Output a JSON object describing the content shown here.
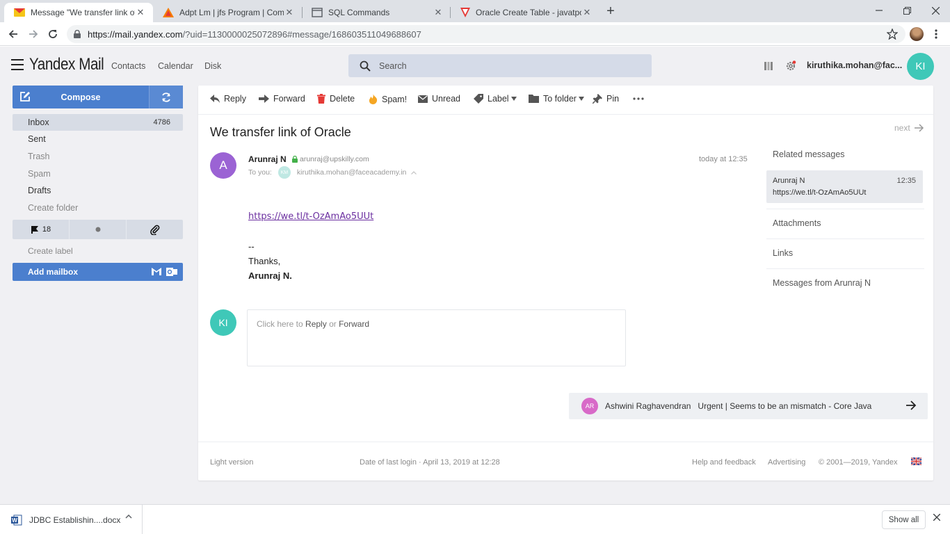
{
  "browser": {
    "tabs": [
      {
        "title": "Message \"We transfer link of Ora",
        "icon": "yandex-mail-icon"
      },
      {
        "title": "Adpt Lm | jfs Program | Comodo",
        "icon": "triangle-logo-icon"
      },
      {
        "title": "SQL Commands",
        "icon": "page-icon"
      },
      {
        "title": "Oracle Create Table - javatpoint",
        "icon": "javatpoint-icon"
      }
    ],
    "url_host": "https://mail.yandex.com",
    "url_path": "/?uid=1130000025072896#message/168603511049688607"
  },
  "header": {
    "logo": "Yandex Mail",
    "nav": [
      "Contacts",
      "Calendar",
      "Disk"
    ],
    "search_placeholder": "Search",
    "user_email": "kiruthika.mohan@fac...",
    "user_initials": "KI"
  },
  "sidebar": {
    "compose_label": "Compose",
    "folders": [
      {
        "label": "Inbox",
        "count": "4786"
      },
      {
        "label": "Sent",
        "count": ""
      },
      {
        "label": "Trash",
        "count": ""
      },
      {
        "label": "Spam",
        "count": ""
      },
      {
        "label": "Drafts",
        "count": ""
      },
      {
        "label": "Create folder",
        "count": ""
      }
    ],
    "flag_count": "18",
    "create_label": "Create label",
    "add_mailbox": "Add mailbox"
  },
  "toolbar": {
    "reply": "Reply",
    "forward": "Forward",
    "delete": "Delete",
    "spam": "Spam!",
    "unread": "Unread",
    "label": "Label",
    "to_folder": "To folder",
    "pin": "Pin"
  },
  "message": {
    "subject": "We transfer link of Oracle",
    "next": "next",
    "sender_initial": "A",
    "sender_name": "Arunraj N",
    "sender_email": "arunraj@upskilly.com",
    "to_label": "To you:",
    "to_initials": "KM",
    "to_email": "kiruthika.mohan@faceacademy.in",
    "time": "today at 12:35",
    "link": "https://we.tl/t-OzAmAo5UUt",
    "sig_dashes": "--",
    "sig_thanks": "Thanks,",
    "sig_name": "Arunraj N."
  },
  "reply_box": {
    "avatar": "KI",
    "prefix": "Click here to",
    "reply": "Reply",
    "or": "or",
    "forward": "Forward"
  },
  "next_thread": {
    "initials": "AR",
    "from": "Ashwini Raghavendran",
    "subject": "Urgent | Seems to be an mismatch - Core Java"
  },
  "related": {
    "title": "Related messages",
    "item_from": "Arunraj N",
    "item_time": "12:35",
    "item_text": "https://we.tl/t-OzAmAo5UUt",
    "attachments": "Attachments",
    "links": "Links",
    "messages_from": "Messages from Arunraj N"
  },
  "footer": {
    "light_version": "Light version",
    "last_login": "Date of last login · April 13, 2019 at 12:28",
    "help": "Help and feedback",
    "advertising": "Advertising",
    "copyright": "© 2001—2019, Yandex"
  },
  "download_bar": {
    "file_name": "JDBC Establishin....docx",
    "show_all": "Show all"
  },
  "colors": {
    "accent": "#4b7fce",
    "avatar_teal": "#3fc8b8",
    "sender_avatar": "#9b63d4",
    "link": "#6b2fa0"
  }
}
